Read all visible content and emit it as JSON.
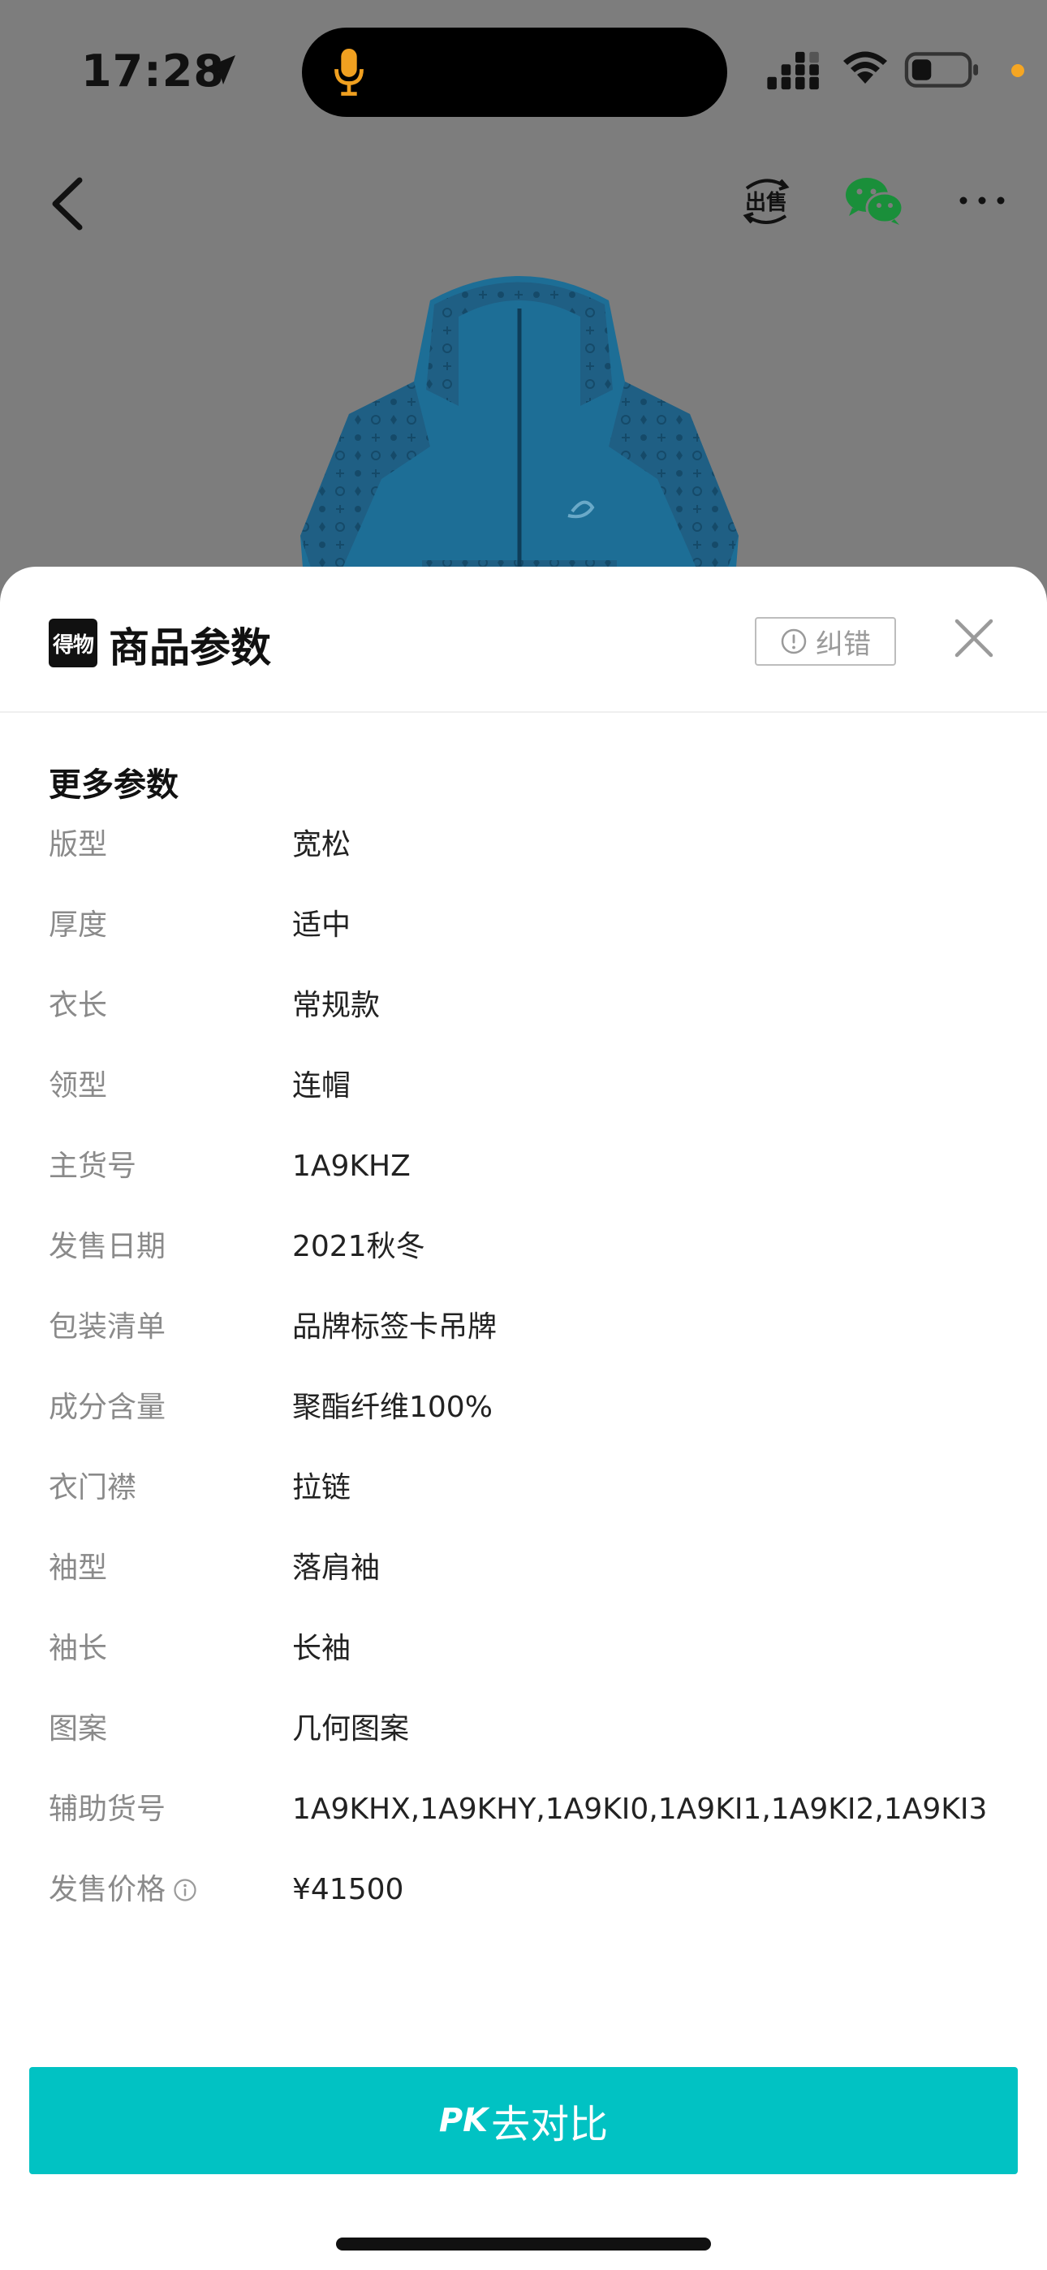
{
  "status_bar": {
    "time": "17:28",
    "icons": [
      "location-arrow-icon",
      "microphone-icon",
      "cellular-signal-icon",
      "wifi-icon",
      "battery-icon"
    ]
  },
  "nav": {
    "icons": [
      "back-arrow-icon",
      "sell-icon",
      "wechat-icon",
      "more-icon"
    ],
    "sell_label": "出售"
  },
  "sheet": {
    "brand_logo_text": "得物",
    "title": "商品参数",
    "report_button_label": "纠错",
    "close_icon": "close-icon"
  },
  "section": {
    "title": "更多参数"
  },
  "params": [
    {
      "label": "版型",
      "value": "宽松"
    },
    {
      "label": "厚度",
      "value": "适中"
    },
    {
      "label": "衣长",
      "value": "常规款"
    },
    {
      "label": "领型",
      "value": "连帽"
    },
    {
      "label": "主货号",
      "value": "1A9KHZ"
    },
    {
      "label": "发售日期",
      "value": "2021秋冬"
    },
    {
      "label": "包装清单",
      "value": "品牌标签卡吊牌"
    },
    {
      "label": "成分含量",
      "value": "聚酯纤维100%"
    },
    {
      "label": "衣门襟",
      "value": "拉链"
    },
    {
      "label": "袖型",
      "value": "落肩袖"
    },
    {
      "label": "袖长",
      "value": "长袖"
    },
    {
      "label": "图案",
      "value": "几何图案"
    },
    {
      "label": "辅助货号",
      "value": "1A9KHX,1A9KHY,1A9KI0,1A9KI1,1A9KI2,1A9KI3"
    },
    {
      "label": "发售价格",
      "value": "¥41500"
    }
  ],
  "footer": {
    "pk_label": "PK",
    "compare_label": "去对比",
    "button_color": "#01c2c3"
  }
}
